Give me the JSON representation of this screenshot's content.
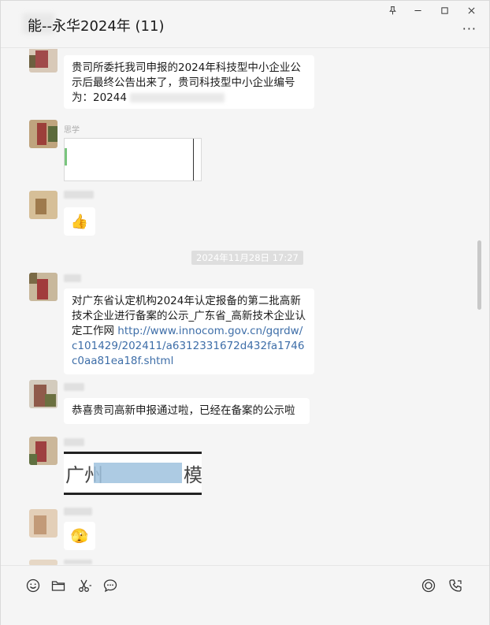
{
  "window": {
    "title": "能--永华2024年 (11)",
    "controls": {
      "pin": "⊥",
      "minimize": "—",
      "maximize": "□",
      "close": "✕"
    },
    "more": "···"
  },
  "messages": {
    "m1_text": "贵司所委托我司申报的2024年科技型中小企业公示后最终公告出来了，贵司科技型中小企业编号为：20244",
    "m2_sender": "思学",
    "m4_text_plain": "对广东省认定机构2024年认定报备的第二批高新技术企业进行备案的公示_广东省_高新技术企业认定工作网 ",
    "m4_link": "http://www.innocom.gov.cn/gqrdw/c101429/202411/a6312331672d432fa1746c0aa81ea18f.shtml",
    "m5_text": "恭喜贵司高新申报通过啦，已经在备案的公示啦",
    "m6_image_text_left": "广州",
    "m6_image_text_right": "模",
    "emoji_thumb": "👍",
    "emoji_laugh": "🫣"
  },
  "timestamp": "2024年11月28日 17:27",
  "toolbar": {
    "icons": [
      "emoji-icon",
      "folder-icon",
      "scissors-icon",
      "chat-history-icon",
      "video-icon",
      "call-icon"
    ]
  },
  "colors": {
    "link": "#3e6ea8",
    "bubble": "#ffffff",
    "background": "#f5f5f5"
  }
}
